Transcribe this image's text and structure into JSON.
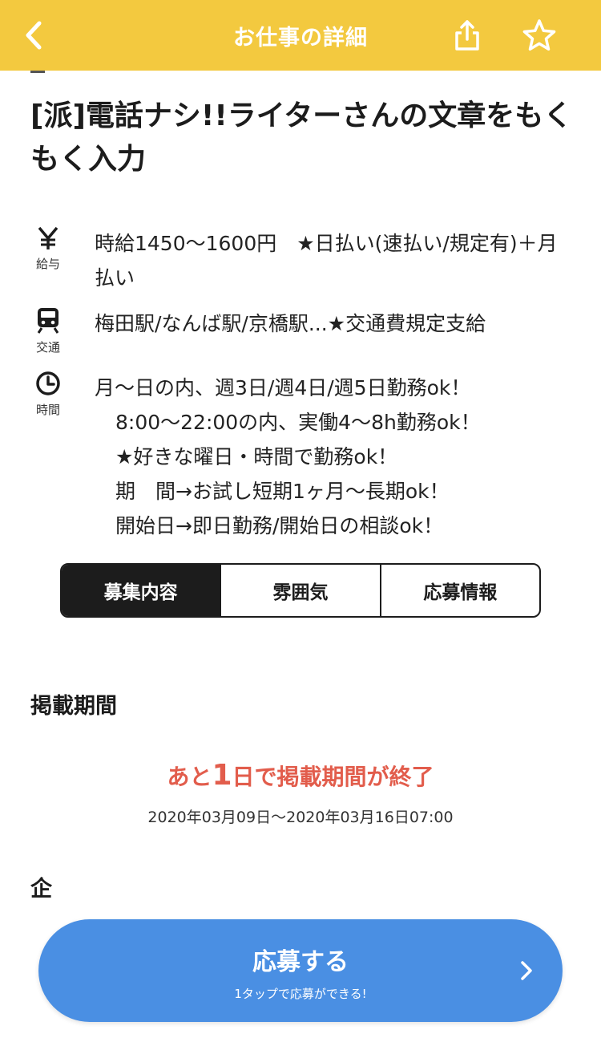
{
  "header": {
    "title": "お仕事の詳細",
    "back_icon": "chevron-left-icon",
    "share_icon": "share-icon",
    "favorite_icon": "star-icon",
    "bg_color": "#f3c93f"
  },
  "job": {
    "title": "[派]電話ナシ!!ライターさんの文章をもくもく入力",
    "salary": {
      "icon": "yen-icon",
      "caption": "給与",
      "text": "時給1450〜1600円　★日払い(速払い/規定有)＋月払い"
    },
    "access": {
      "icon": "train-icon",
      "caption": "交通",
      "text": "梅田駅/なんば駅/京橋駅...★交通費規定支給"
    },
    "hours": {
      "icon": "clock-icon",
      "caption": "時間",
      "line1": "月〜日の内、週3日/週4日/週5日勤務ok！",
      "line2": "8:00〜22:00の内、実働4〜8h勤務ok！",
      "line3": "★好きな曜日・時間で勤務ok！",
      "line4": "期　間→お試し短期1ヶ月〜長期ok！",
      "line5": "開始日→即日勤務/開始日の相談ok！"
    }
  },
  "tabs": [
    {
      "label": "募集内容",
      "active": true
    },
    {
      "label": "雰囲気",
      "active": false
    },
    {
      "label": "応募情報",
      "active": false
    }
  ],
  "listing": {
    "section_title": "掲載期間",
    "remaining_prefix": "あと",
    "remaining_days": "1",
    "remaining_suffix": "日で掲載期間が終了",
    "period": "2020年03月09日〜2020年03月16日07:00",
    "accent_color": "#e25d4c"
  },
  "next_section": {
    "title_partial": "企"
  },
  "apply": {
    "label": "応募する",
    "sub_label": "1タップで応募ができる!",
    "chevron_icon": "chevron-right-icon",
    "color": "#4a8fe3"
  }
}
